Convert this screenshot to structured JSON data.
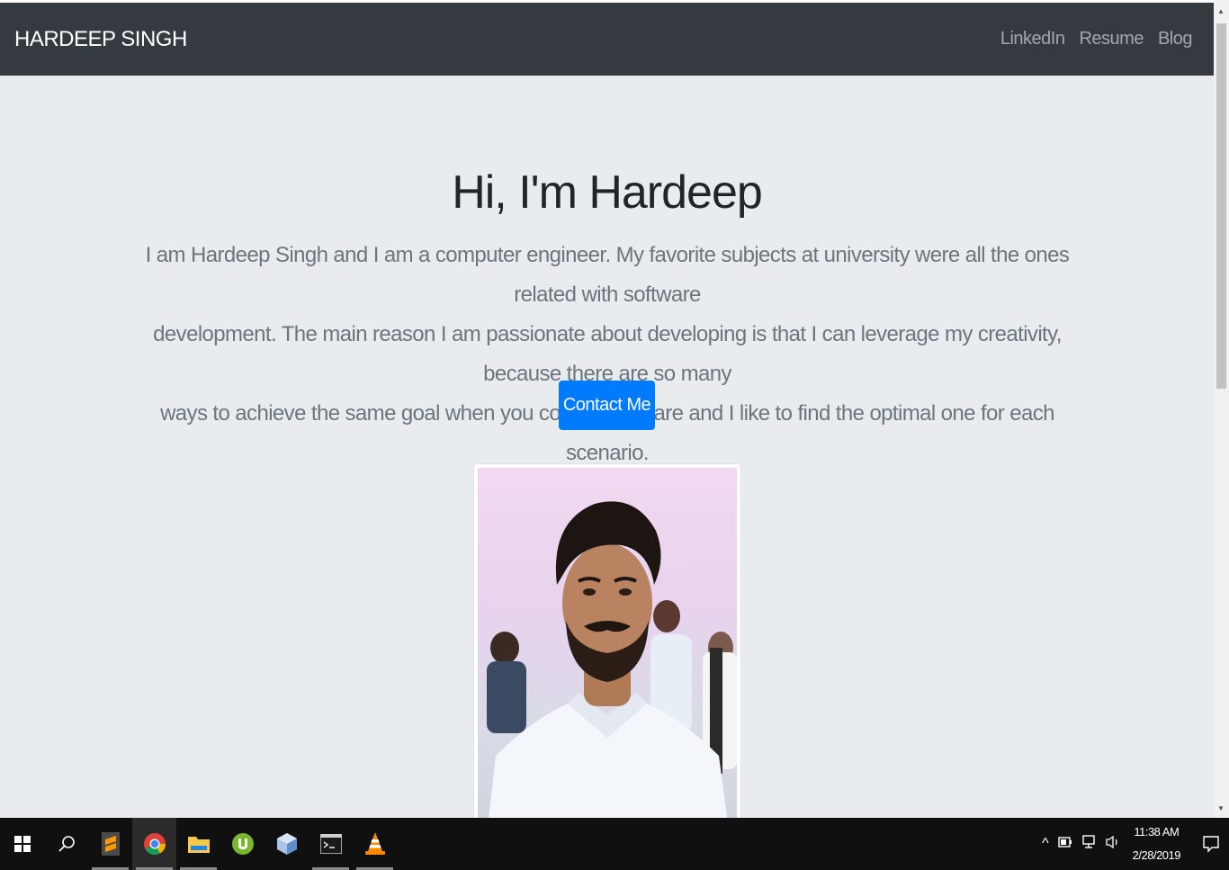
{
  "navbar": {
    "brand": "HARDEEP SINGH",
    "links": [
      "LinkedIn",
      "Resume",
      "Blog"
    ]
  },
  "hero": {
    "title": "Hi, I'm Hardeep",
    "text_lines": [
      "I am Hardeep Singh and I am a computer engineer. My favorite subjects at university were all the ones related with software",
      "development. The main reason I am passionate about developing is that I can leverage my creativity, because there are so many",
      "ways to achieve the same goal when you code a software and I like to find the optimal one for each scenario."
    ],
    "button_label": "Contact Me"
  },
  "taskbar": {
    "apps": [
      "windows-start",
      "search",
      "sublime-text",
      "chrome",
      "file-explorer",
      "utorrent",
      "virtualbox",
      "command-prompt",
      "vlc"
    ],
    "time": "11:38 AM",
    "date": "2/28/2019"
  },
  "colors": {
    "navbar_bg": "#343a40",
    "page_bg": "#e9ecef",
    "button_bg": "#007bff",
    "taskbar_bg": "#101010"
  }
}
